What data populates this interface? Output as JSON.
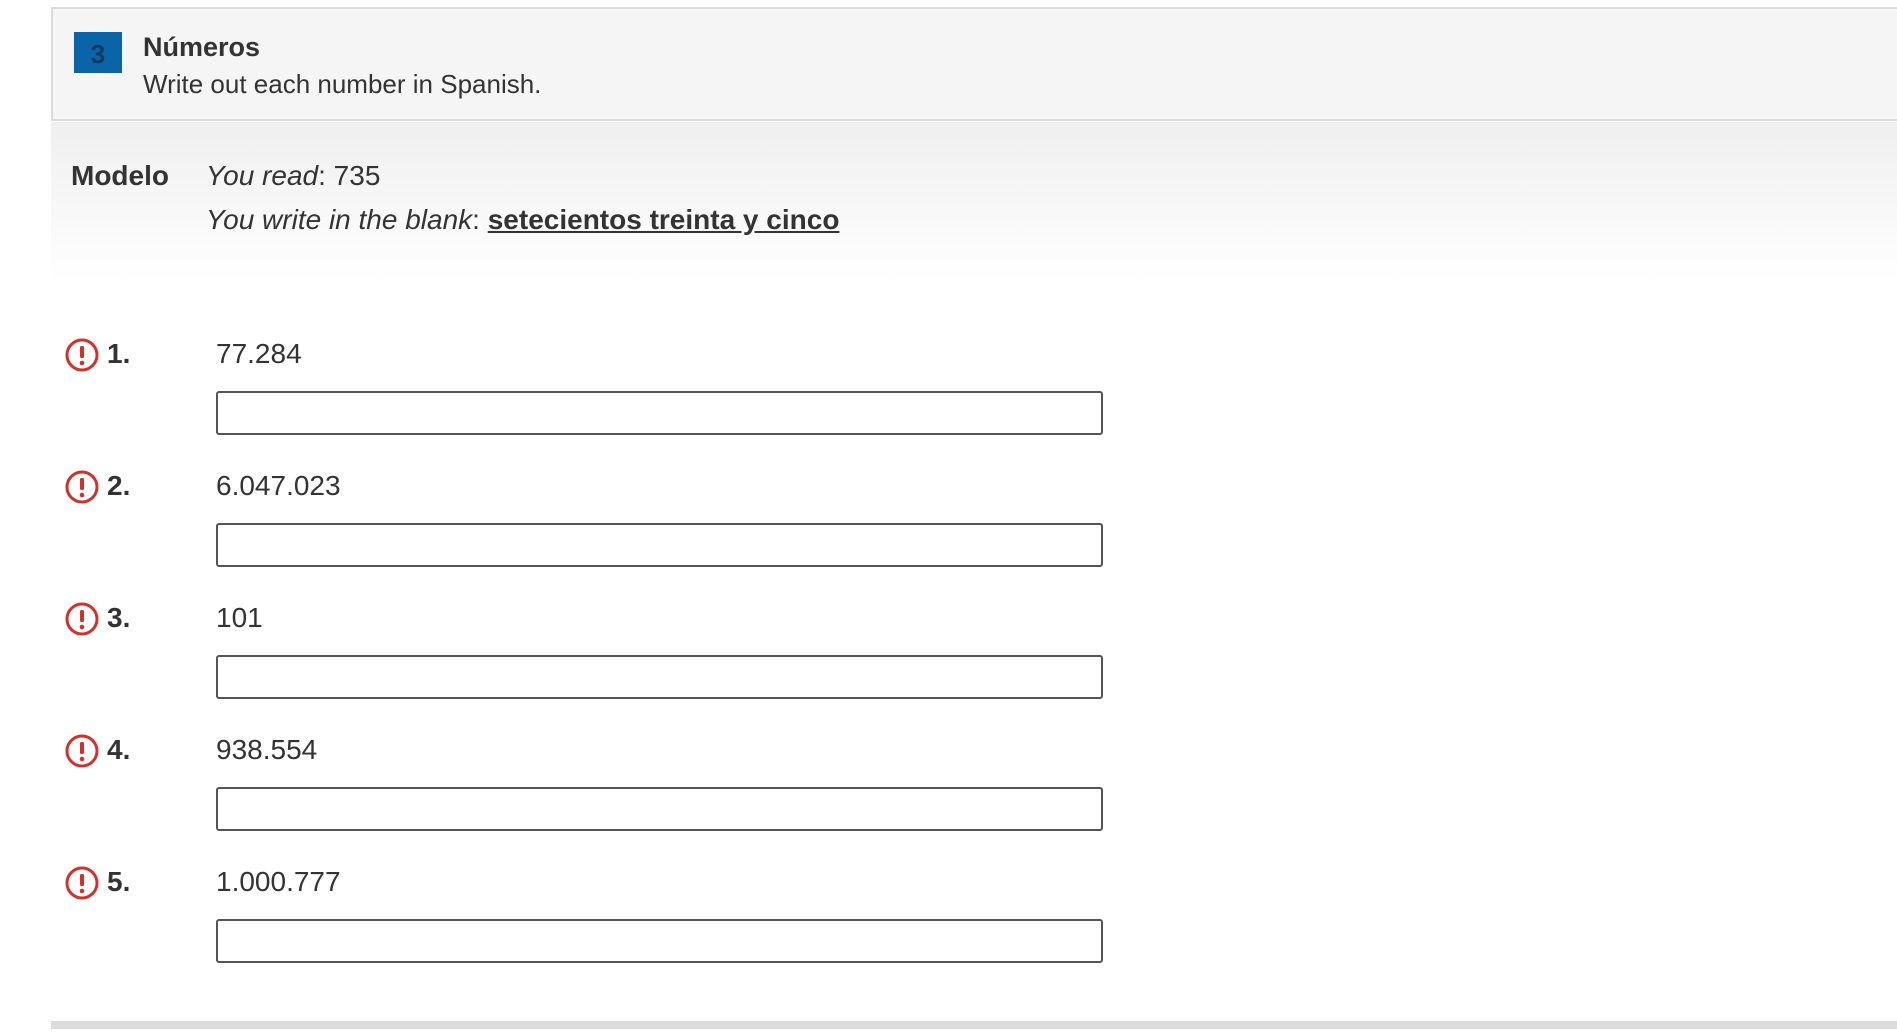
{
  "activity": {
    "number": "3",
    "title": "Números",
    "instructions": "Write out each number in Spanish."
  },
  "model": {
    "label": "Modelo",
    "read_prefix": "You read",
    "read_value": ": 735",
    "write_prefix": "You write in the blank",
    "write_sep": ": ",
    "write_answer": "setecientos treinta y cinco"
  },
  "items": [
    {
      "num": "1.",
      "value": "77.284",
      "answer": "",
      "status_icon": "alert-circle-icon"
    },
    {
      "num": "2.",
      "value": "6.047.023",
      "answer": "",
      "status_icon": "alert-circle-icon"
    },
    {
      "num": "3.",
      "value": "101",
      "answer": "",
      "status_icon": "alert-circle-icon"
    },
    {
      "num": "4.",
      "value": "938.554",
      "answer": "",
      "status_icon": "alert-circle-icon"
    },
    {
      "num": "5.",
      "value": "1.000.777",
      "answer": "",
      "status_icon": "alert-circle-icon"
    }
  ],
  "colors": {
    "badge": "#0b63a8",
    "alert": "#d0312d",
    "header_bg": "#f5f5f5"
  }
}
